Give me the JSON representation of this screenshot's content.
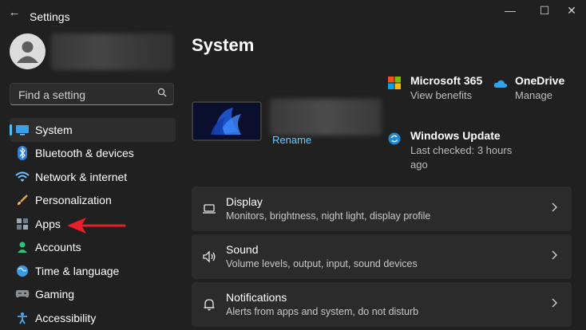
{
  "window": {
    "title": "Settings",
    "controls": {
      "minimize": "—",
      "maximize": "☐",
      "close": "✕"
    }
  },
  "search": {
    "placeholder": "Find a setting"
  },
  "sidebar": {
    "items": [
      {
        "label": "System",
        "icon": "monitor-icon",
        "active": true
      },
      {
        "label": "Bluetooth & devices",
        "icon": "bluetooth-icon"
      },
      {
        "label": "Network & internet",
        "icon": "wifi-icon"
      },
      {
        "label": "Personalization",
        "icon": "brush-icon"
      },
      {
        "label": "Apps",
        "icon": "apps-icon"
      },
      {
        "label": "Accounts",
        "icon": "person-icon"
      },
      {
        "label": "Time & language",
        "icon": "globe-icon"
      },
      {
        "label": "Gaming",
        "icon": "controller-icon"
      },
      {
        "label": "Accessibility",
        "icon": "accessibility-icon"
      }
    ]
  },
  "main": {
    "title": "System",
    "device": {
      "rename_label": "Rename"
    },
    "quick": [
      {
        "title": "Microsoft 365",
        "subtitle": "View benefits",
        "icon": "microsoft-logo-icon"
      },
      {
        "title": "OneDrive",
        "subtitle": "Manage",
        "icon": "cloud-icon"
      },
      {
        "title": "Windows Update",
        "subtitle": "Last checked: 3 hours ago",
        "icon": "sync-icon"
      }
    ],
    "cards": [
      {
        "title": "Display",
        "subtitle": "Monitors, brightness, night light, display profile",
        "icon": "laptop-icon"
      },
      {
        "title": "Sound",
        "subtitle": "Volume levels, output, input, sound devices",
        "icon": "speaker-icon"
      },
      {
        "title": "Notifications",
        "subtitle": "Alerts from apps and system, do not disturb",
        "icon": "bell-icon"
      }
    ]
  },
  "colors": {
    "accent": "#4cc2ff",
    "link": "#60cdff",
    "annotation_arrow": "#e5202a"
  }
}
